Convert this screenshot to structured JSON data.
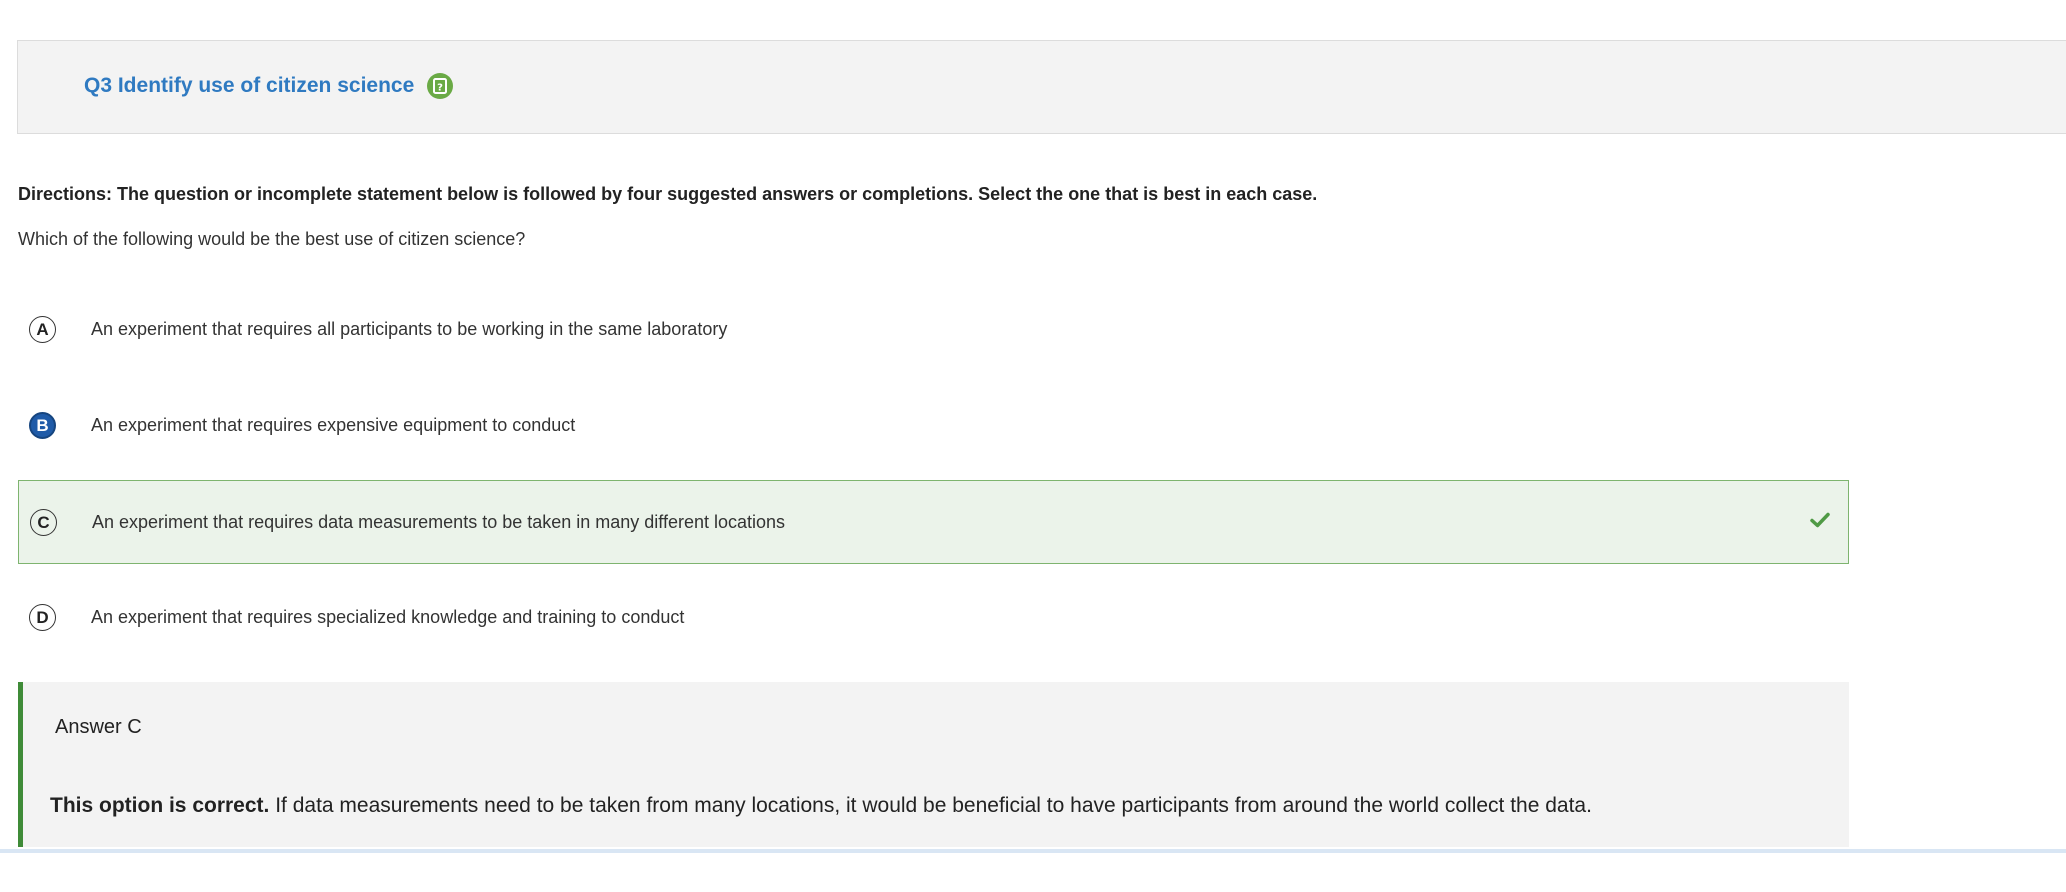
{
  "question": {
    "title": "Q3 Identify use of citizen science",
    "type_icon": "question-mark-icon"
  },
  "directions": "Directions: The question or incomplete statement below is followed by four suggested answers or completions. Select the one that is best in each case.",
  "stem": "Which of the following would be the best use of citizen science?",
  "options": [
    {
      "letter": "A",
      "text": "An experiment that requires all participants to be working in the same laboratory"
    },
    {
      "letter": "B",
      "text": "An experiment that requires expensive equipment to conduct"
    },
    {
      "letter": "C",
      "text": "An experiment that requires data measurements to be taken in many different locations"
    },
    {
      "letter": "D",
      "text": "An experiment that requires specialized knowledge and training to conduct"
    }
  ],
  "selected_option": "B",
  "correct_option": "C",
  "answer": {
    "heading": "Answer C",
    "verdict": "This option is correct.",
    "explanation": " If data measurements need to be taken from many locations, it would be beneficial to have participants from around the world collect the data."
  },
  "colors": {
    "title": "#2f7ac1",
    "selected": "#1f5ba8",
    "correct_bg": "#ebf3ea",
    "correct_border": "#7eb46f",
    "answer_accent": "#3f8b38"
  }
}
